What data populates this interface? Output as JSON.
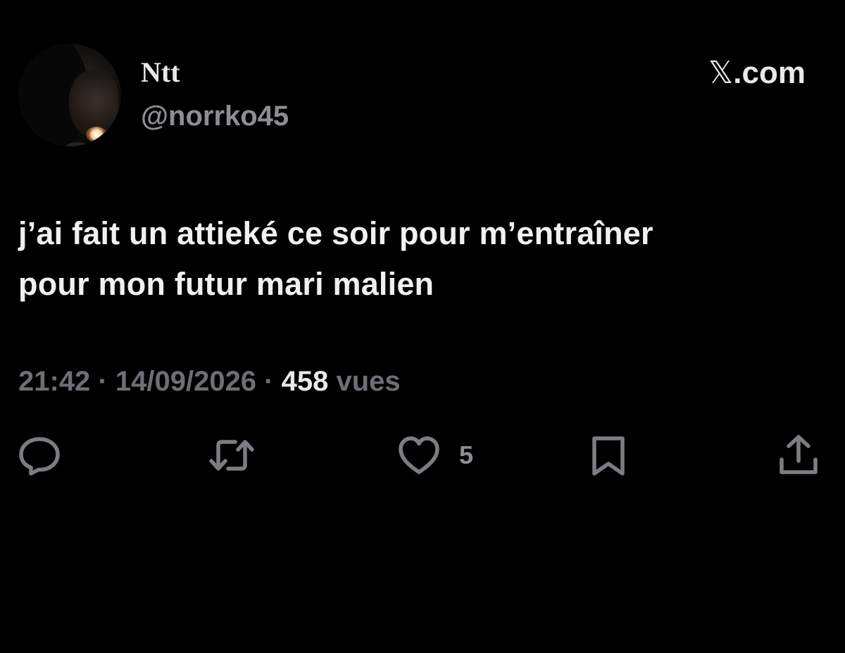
{
  "author": {
    "display_name": "Ntt",
    "handle": "@norrko45",
    "avatar_icon": "avatar"
  },
  "brand": {
    "logo_glyph": "𝕏",
    "suffix": ".com"
  },
  "tweet": {
    "line1": "j’ai fait un attieké ce soir pour m’entraîner",
    "line2": "pour mon futur mari malien"
  },
  "meta": {
    "time": "21:42",
    "separator": " · ",
    "date": "14/09/2026",
    "views_count": "458",
    "views_label": " vues"
  },
  "actions": {
    "reply_icon": "speech-bubble-icon",
    "retweet_icon": "retweet-icon",
    "like_icon": "heart-icon",
    "like_count": "5",
    "bookmark_icon": "bookmark-icon",
    "share_icon": "share-icon"
  },
  "colors": {
    "background": "#000000",
    "primary_text": "#e7e9ea",
    "secondary_text": "#6c7075",
    "icon": "#7a7e83"
  }
}
